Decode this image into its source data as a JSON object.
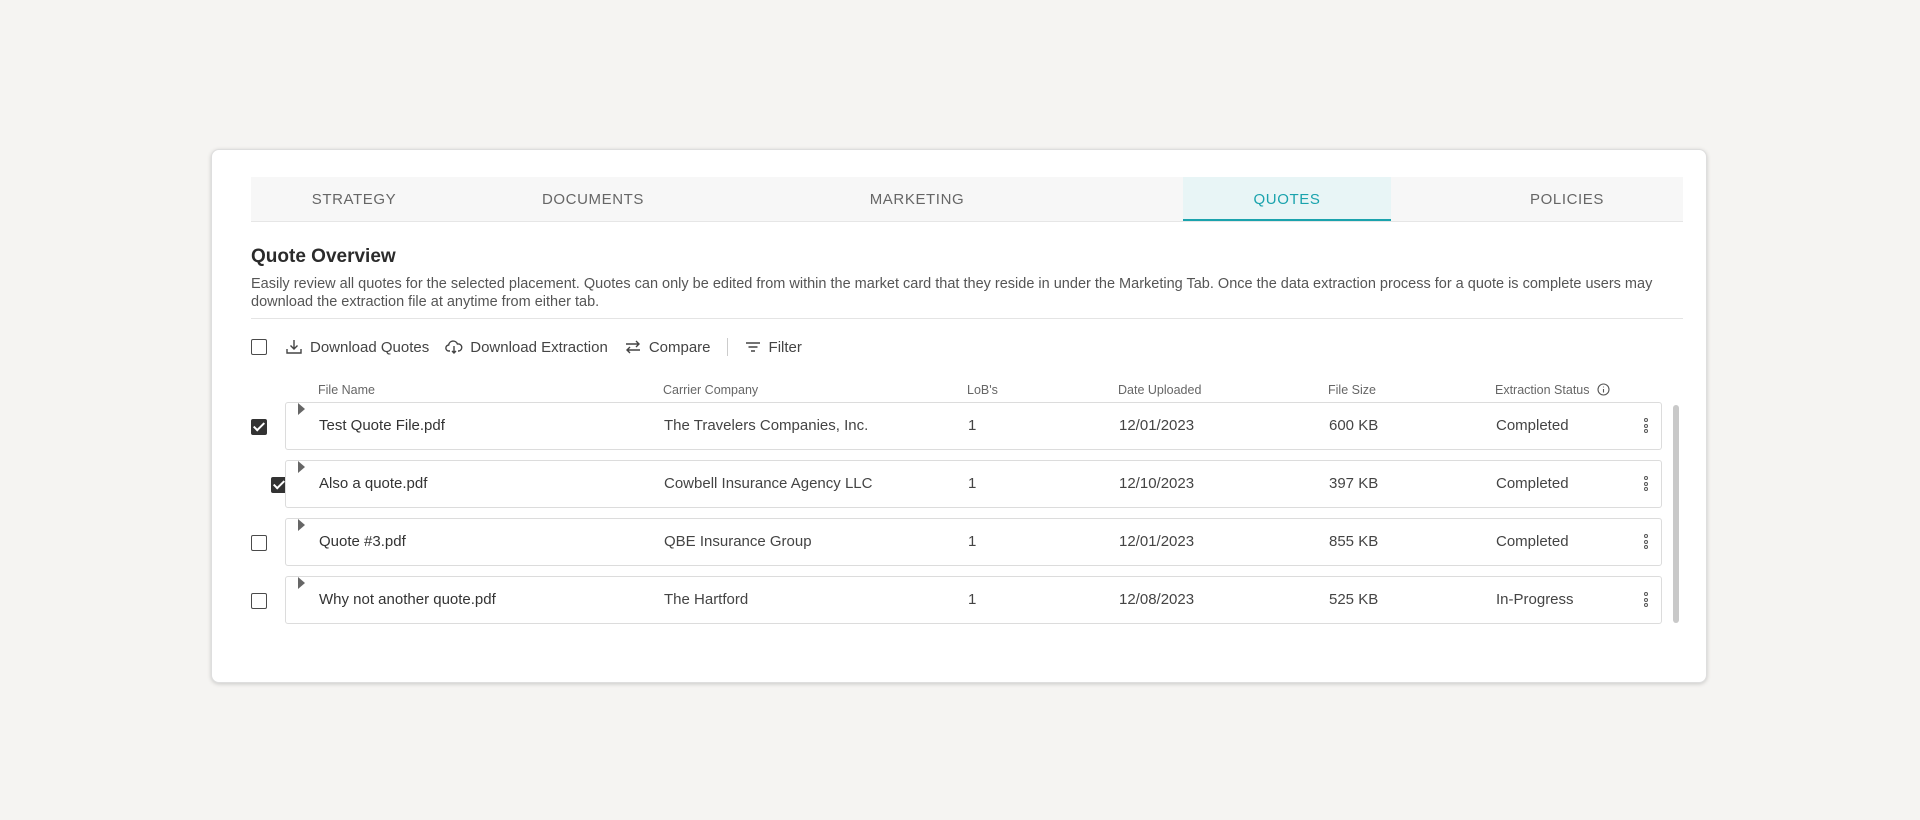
{
  "tabs": [
    {
      "label": "STRATEGY",
      "active": false
    },
    {
      "label": "DOCUMENTS",
      "active": false
    },
    {
      "label": "MARKETING",
      "active": false
    },
    {
      "label": "QUOTES",
      "active": true
    },
    {
      "label": "POLICIES",
      "active": false
    }
  ],
  "overview": {
    "title": "Quote Overview",
    "description": "Easily review all quotes for the selected placement. Quotes can only be edited from within the market card that they reside in under the Marketing Tab. Once the data extraction process for a quote is complete users may download the extraction file at anytime from either tab."
  },
  "toolbar": {
    "select_all_checked": false,
    "download_quotes": "Download Quotes",
    "download_extraction": "Download Extraction",
    "compare": "Compare",
    "filter": "Filter"
  },
  "columns": {
    "file_name": "File Name",
    "carrier": "Carrier Company",
    "lobs": "LoB's",
    "date_uploaded": "Date Uploaded",
    "file_size": "File Size",
    "status": "Extraction Status"
  },
  "rows": [
    {
      "checked": true,
      "file_name": "Test Quote File.pdf",
      "carrier": "The Travelers Companies, Inc.",
      "lobs": "1",
      "date": "12/01/2023",
      "size": "600 KB",
      "status": "Completed"
    },
    {
      "checked": true,
      "file_name": "Also a quote.pdf",
      "carrier": "Cowbell Insurance Agency LLC",
      "lobs": "1",
      "date": "12/10/2023",
      "size": "397 KB",
      "status": "Completed"
    },
    {
      "checked": false,
      "file_name": "Quote #3.pdf",
      "carrier": "QBE Insurance Group",
      "lobs": "1",
      "date": "12/01/2023",
      "size": "855 KB",
      "status": "Completed"
    },
    {
      "checked": false,
      "file_name": "Why not another quote.pdf",
      "carrier": "The Hartford",
      "lobs": "1",
      "date": "12/08/2023",
      "size": "525 KB",
      "status": "In-Progress"
    }
  ],
  "colors": {
    "accent": "#1aa3ad",
    "active_tab_bg": "#e8f5f6"
  },
  "icons": [
    "download-icon",
    "cloud-download-icon",
    "compare-arrows-icon",
    "filter-icon",
    "info-icon",
    "expand-caret-icon",
    "kebab-menu-icon"
  ]
}
